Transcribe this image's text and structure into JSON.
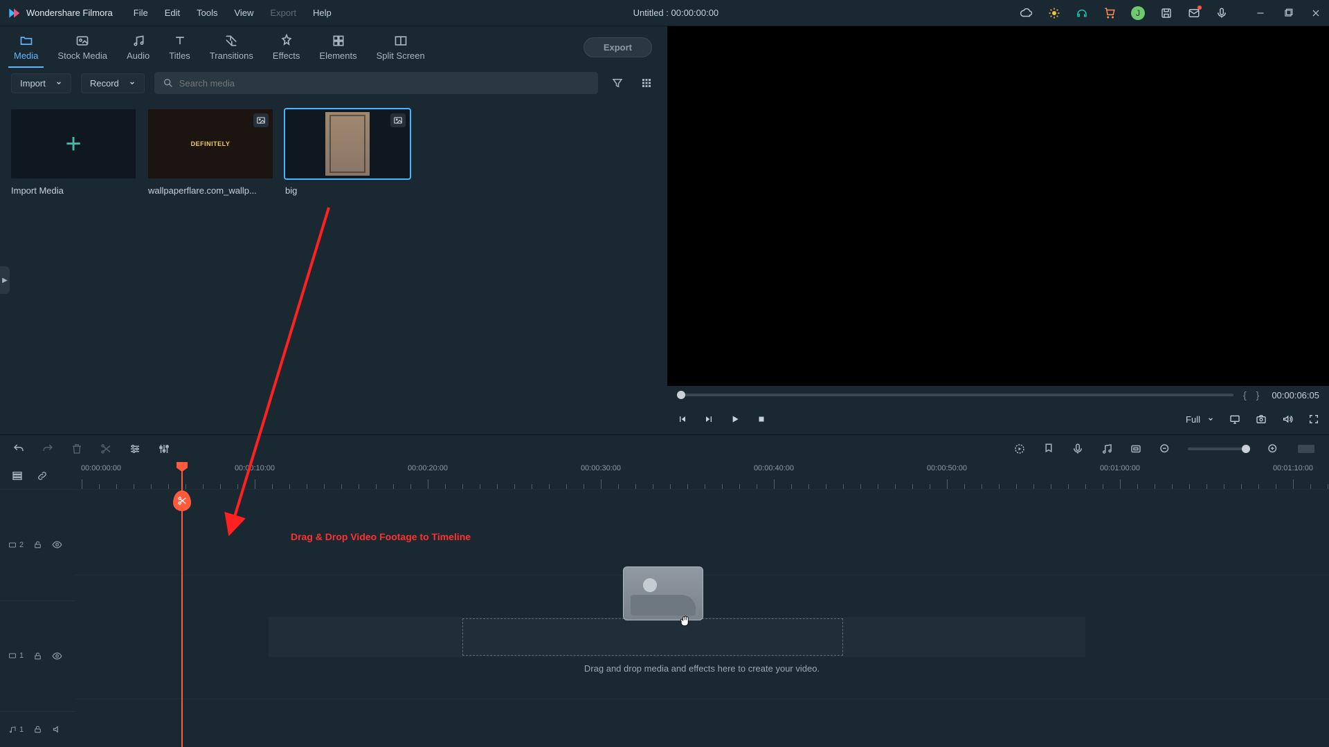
{
  "titlebar": {
    "app_name": "Wondershare Filmora",
    "menu": [
      "File",
      "Edit",
      "Tools",
      "View",
      "Export",
      "Help"
    ],
    "menu_disabled_index": 4,
    "doc_title": "Untitled : 00:00:00:00",
    "avatar_letter": "J"
  },
  "tabs": {
    "items": [
      "Media",
      "Stock Media",
      "Audio",
      "Titles",
      "Transitions",
      "Effects",
      "Elements",
      "Split Screen"
    ],
    "active_index": 0,
    "export_label": "Export"
  },
  "toolbar": {
    "import_label": "Import",
    "record_label": "Record",
    "search_placeholder": "Search media"
  },
  "media": {
    "items": [
      {
        "label": "Import Media",
        "type": "add"
      },
      {
        "label": "wallpaperflare.com_wallp...",
        "type": "img1"
      },
      {
        "label": "big",
        "type": "img2",
        "selected": true
      }
    ],
    "thumb1_text": "DEFINITELY"
  },
  "preview": {
    "open_brace": "{",
    "close_brace": "}",
    "time": "00:00:06:05",
    "quality": "Full"
  },
  "timeline": {
    "ruler_start": "00:00:00:00",
    "labels": [
      "00:00:10:00",
      "00:00:20:00",
      "00:00:30:00",
      "00:00:40:00",
      "00:00:50:00",
      "00:01:00:00",
      "00:01:10:00"
    ],
    "track_v2": "2",
    "track_v1": "1",
    "track_a1": "1",
    "drop_hint": "Drag and drop media and effects here to create your video."
  },
  "annotation": {
    "text": "Drag & Drop Video Footage to Timeline"
  }
}
